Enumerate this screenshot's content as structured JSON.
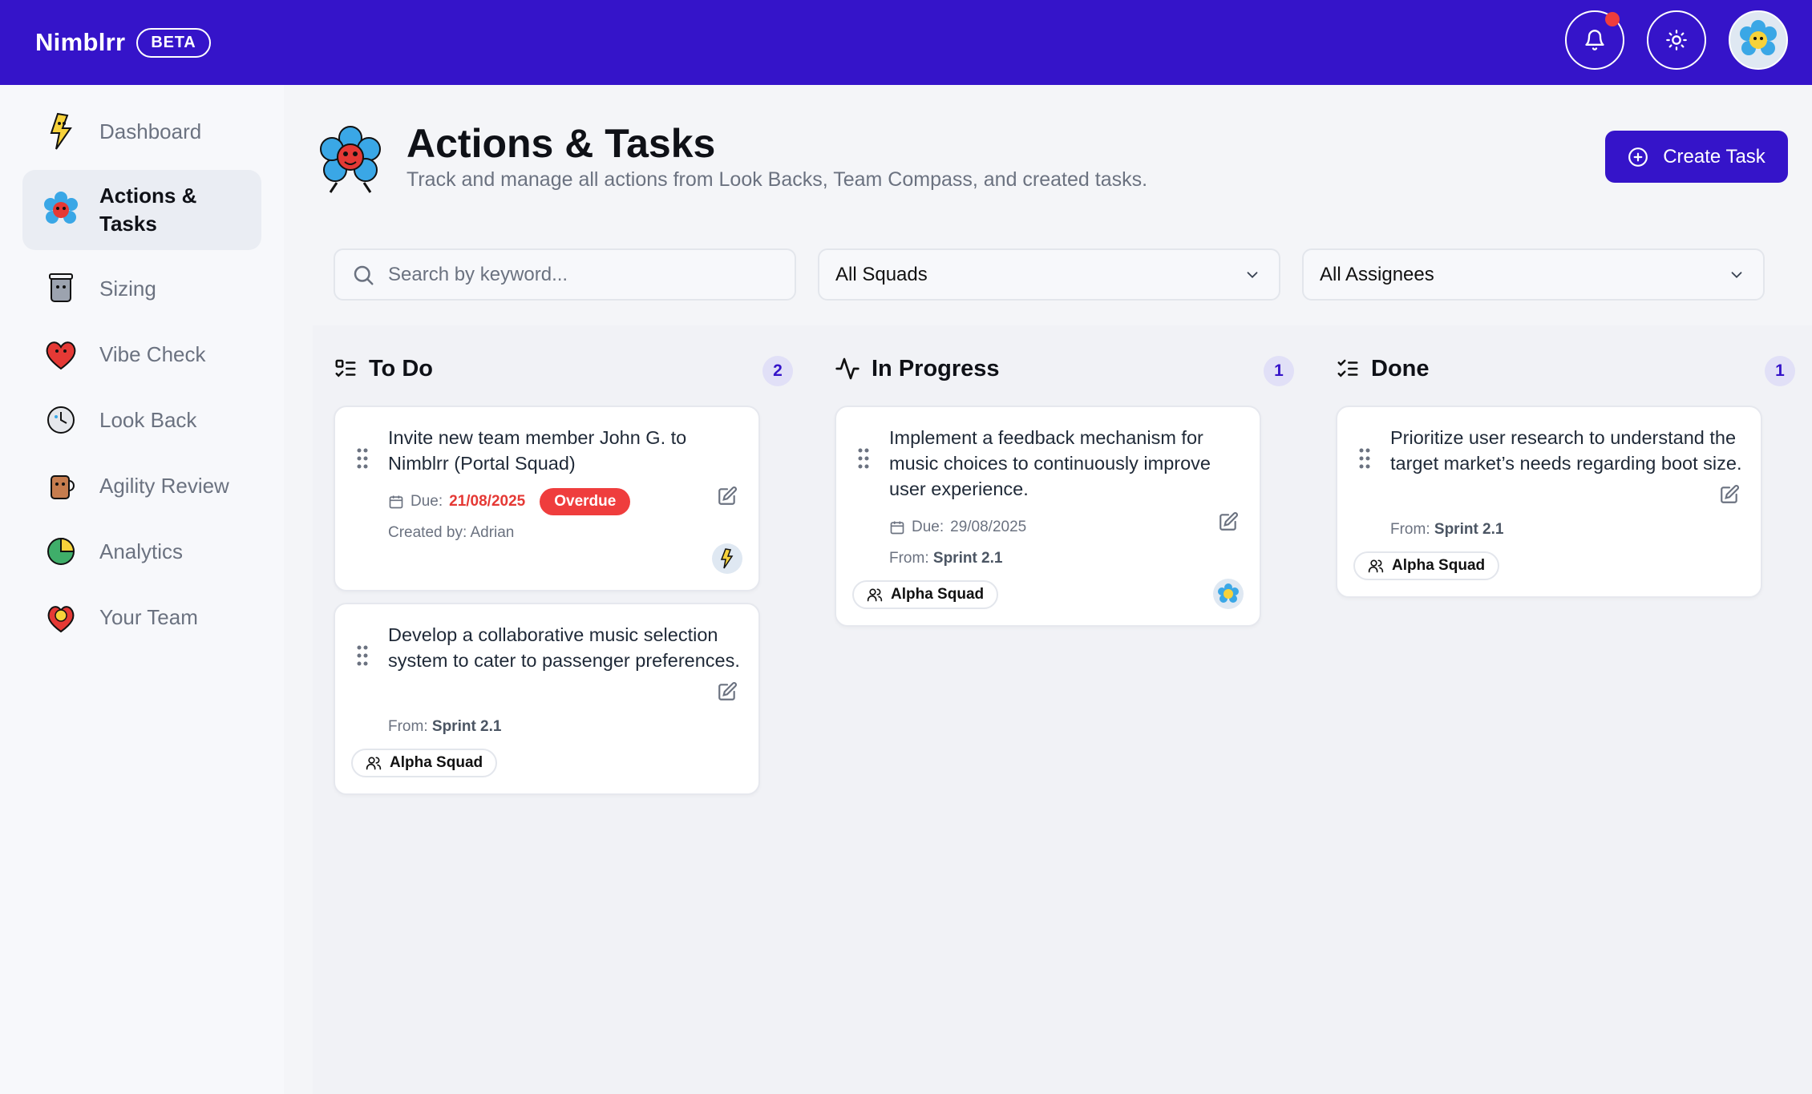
{
  "app": {
    "name": "Nimblrr",
    "badge": "BETA"
  },
  "topbar": {
    "icons": [
      "bell-icon",
      "sun-icon",
      "user-avatar"
    ]
  },
  "sidebar": {
    "items": [
      {
        "label": "Dashboard",
        "active": false
      },
      {
        "label": "Actions & Tasks",
        "active": true
      },
      {
        "label": "Sizing",
        "active": false
      },
      {
        "label": "Vibe Check",
        "active": false
      },
      {
        "label": "Look Back",
        "active": false
      },
      {
        "label": "Agility Review",
        "active": false
      },
      {
        "label": "Analytics",
        "active": false
      },
      {
        "label": "Your Team",
        "active": false
      }
    ]
  },
  "page": {
    "title": "Actions & Tasks",
    "subtitle": "Track and manage all actions from Look Backs, Team Compass, and created tasks.",
    "create_button": "Create Task"
  },
  "filters": {
    "search_placeholder": "Search by keyword...",
    "squads": "All Squads",
    "assignees": "All Assignees"
  },
  "columns": [
    {
      "title": "To Do",
      "count": "2",
      "cards": [
        {
          "text": "Invite new team member John G. to Nimblrr (Portal Squad)",
          "due_label": "Due:",
          "due_date": "21/08/2025",
          "status": "Overdue",
          "created_by": "Created by: Adrian"
        },
        {
          "text": "Develop a collaborative music selection system to cater to passenger preferences.",
          "from_label": "From:",
          "from_value": "Sprint 2.1",
          "squad": "Alpha Squad"
        }
      ]
    },
    {
      "title": "In Progress",
      "count": "1",
      "cards": [
        {
          "text": "Implement a feedback mechanism for music choices to continuously improve user experience.",
          "due_label": "Due:",
          "due_date": "29/08/2025",
          "from_label": "From:",
          "from_value": "Sprint 2.1",
          "squad": "Alpha Squad"
        }
      ]
    },
    {
      "title": "Done",
      "count": "1",
      "cards": [
        {
          "text": "Prioritize user research to understand the target market’s needs regarding boot size.",
          "from_label": "From:",
          "from_value": "Sprint 2.1",
          "squad": "Alpha Squad"
        }
      ]
    }
  ],
  "colors": {
    "brand": "#3514c9",
    "danger": "#ef3d3d",
    "muted": "#6b7280"
  }
}
